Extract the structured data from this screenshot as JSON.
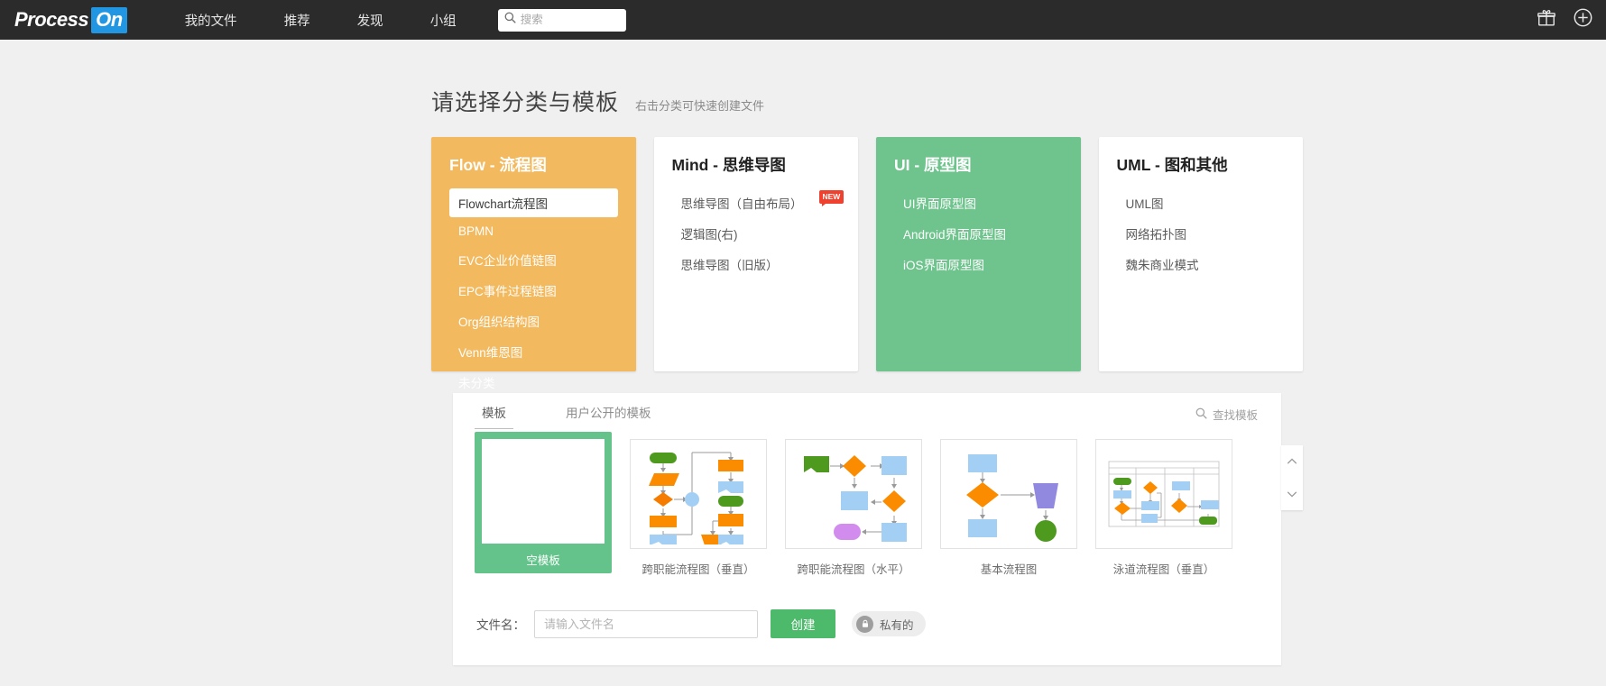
{
  "header": {
    "logo_primary": "Process",
    "logo_accent": "On",
    "nav": [
      {
        "label": "我的文件"
      },
      {
        "label": "推荐"
      },
      {
        "label": "发现"
      },
      {
        "label": "小组"
      }
    ],
    "search_placeholder": "搜索",
    "search_value": "",
    "icons": [
      {
        "name": "gift-icon"
      },
      {
        "name": "plus-circle-icon"
      }
    ],
    "colors": {
      "bar_bg": "#2B2B2B",
      "logo_badge": "#2196E3"
    }
  },
  "page": {
    "title": "请选择分类与模板",
    "subtitle": "右击分类可快速创建文件"
  },
  "categories": [
    {
      "title": "Flow - 流程图",
      "theme": "amber",
      "color": "#F2B95E",
      "items": [
        {
          "label": "Flowchart流程图",
          "selected": true
        },
        {
          "label": "BPMN",
          "selected": false
        },
        {
          "label": "EVC企业价值链图",
          "selected": false
        },
        {
          "label": "EPC事件过程链图",
          "selected": false
        },
        {
          "label": "Org组织结构图",
          "selected": false
        },
        {
          "label": "Venn维恩图",
          "selected": false
        },
        {
          "label": "未分类",
          "selected": false
        }
      ]
    },
    {
      "title": "Mind - 思维导图",
      "theme": "white",
      "color": "#FFFFFF",
      "items": [
        {
          "label": "思维导图（自由布局）",
          "selected": false,
          "badge": "NEW"
        },
        {
          "label": "逻辑图(右)",
          "selected": false
        },
        {
          "label": "思维导图（旧版）",
          "selected": false
        }
      ]
    },
    {
      "title": "UI - 原型图",
      "theme": "green",
      "color": "#6FC48E",
      "items": [
        {
          "label": "UI界面原型图",
          "selected": false
        },
        {
          "label": "Android界面原型图",
          "selected": false
        },
        {
          "label": "iOS界面原型图",
          "selected": false
        }
      ]
    },
    {
      "title": "UML - 图和其他",
      "theme": "white",
      "color": "#FFFFFF",
      "items": [
        {
          "label": "UML图",
          "selected": false
        },
        {
          "label": "网络拓扑图",
          "selected": false
        },
        {
          "label": "魏朱商业模式",
          "selected": false
        }
      ]
    }
  ],
  "panel": {
    "tabs": [
      {
        "label": "模板",
        "active": true
      },
      {
        "label": "用户公开的模板",
        "active": false
      }
    ],
    "find_template_label": "查找模板",
    "find_template_icon": "search-icon",
    "scroll_up_icon": "chevron-up-icon",
    "scroll_down_icon": "chevron-down-icon",
    "templates": [
      {
        "label": "空模板",
        "kind": "blank",
        "selected": true
      },
      {
        "label": "跨职能流程图（垂直）",
        "kind": "cross-functional-vertical",
        "selected": false
      },
      {
        "label": "跨职能流程图（水平）",
        "kind": "cross-functional-horizontal",
        "selected": false
      },
      {
        "label": "基本流程图",
        "kind": "basic-flowchart",
        "selected": false
      },
      {
        "label": "泳道流程图（垂直）",
        "kind": "swimlane-vertical",
        "selected": false
      }
    ]
  },
  "form": {
    "filename_label": "文件名：",
    "filename_value": "",
    "filename_placeholder": "请输入文件名",
    "create_label": "创建",
    "privacy_label": "私有的",
    "privacy_icon": "lock-icon",
    "create_color": "#4CB96B"
  }
}
